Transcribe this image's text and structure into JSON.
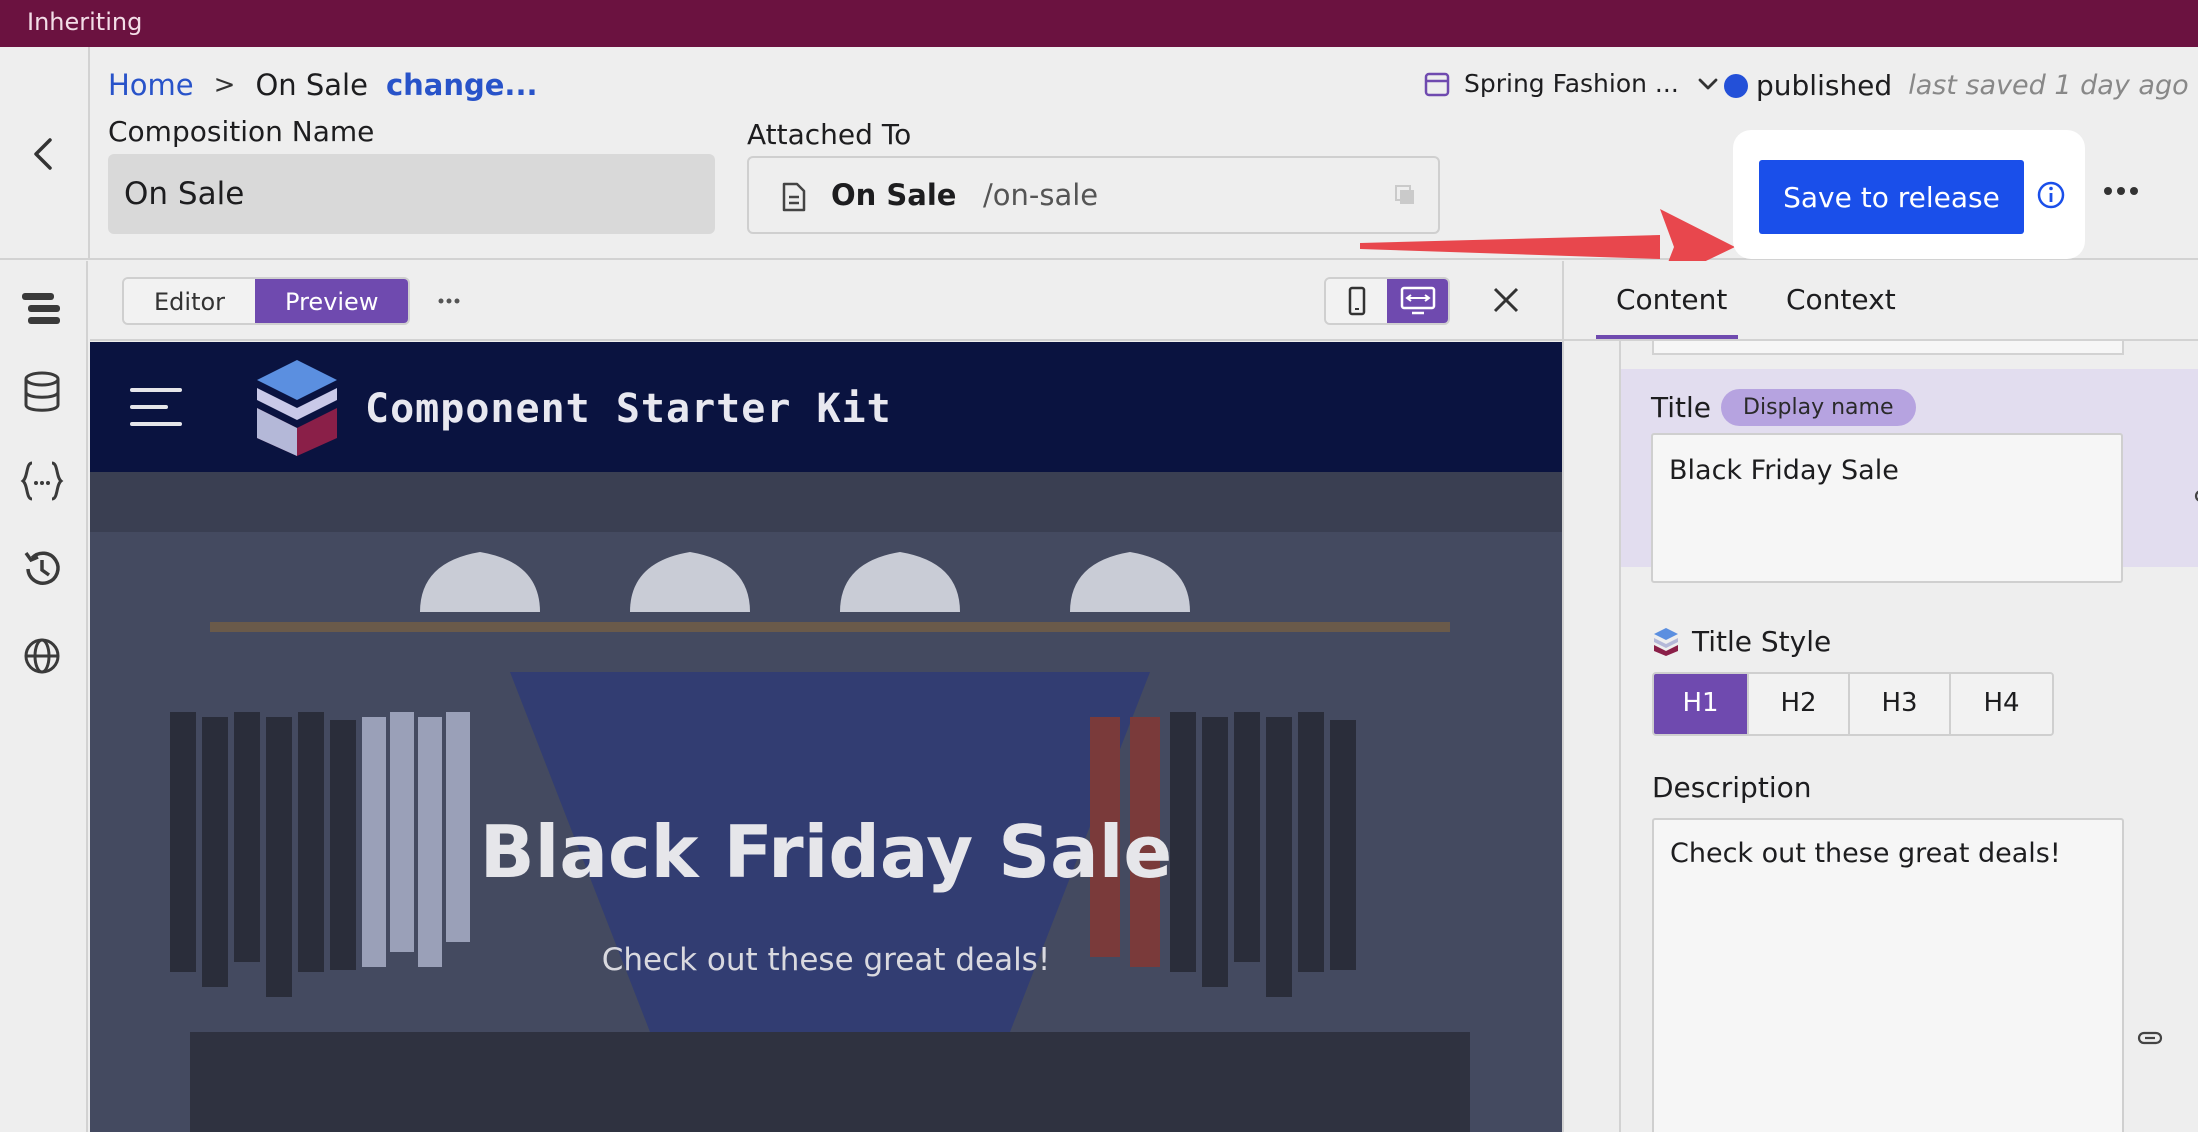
{
  "topbar": {
    "text": "Inheriting"
  },
  "breadcrumb": {
    "home": "Home",
    "separator": ">",
    "current": "On Sale",
    "change": "change..."
  },
  "composition": {
    "label": "Composition Name",
    "value": "On Sale"
  },
  "attached": {
    "label": "Attached To",
    "name": "On Sale",
    "path": "/on-sale"
  },
  "release": {
    "name": "Spring Fashion ..."
  },
  "status": {
    "label": "published",
    "last_saved": "last saved 1 day ago"
  },
  "actions": {
    "save_label": "Save to release"
  },
  "toolbar": {
    "editor": "Editor",
    "preview": "Preview"
  },
  "site": {
    "title": "Component Starter Kit",
    "hero_title": "Black Friday Sale",
    "hero_subtitle": "Check out these great deals!"
  },
  "panel": {
    "tabs": [
      "Content",
      "Context"
    ],
    "title_label": "Title",
    "title_badge": "Display name",
    "title_value": "Black Friday Sale",
    "title_style_label": "Title Style",
    "heading_options": [
      "H1",
      "H2",
      "H3",
      "H4"
    ],
    "selected_heading": "H1",
    "description_label": "Description",
    "description_value": "Check out these great deals!"
  },
  "colors": {
    "topbar": "#6b1240",
    "accent_purple": "#6f4aaf",
    "save_blue": "#1a4fea",
    "status_dot": "#2350d8",
    "arrow_red": "#e8474d",
    "site_nav": "#0a1340"
  }
}
